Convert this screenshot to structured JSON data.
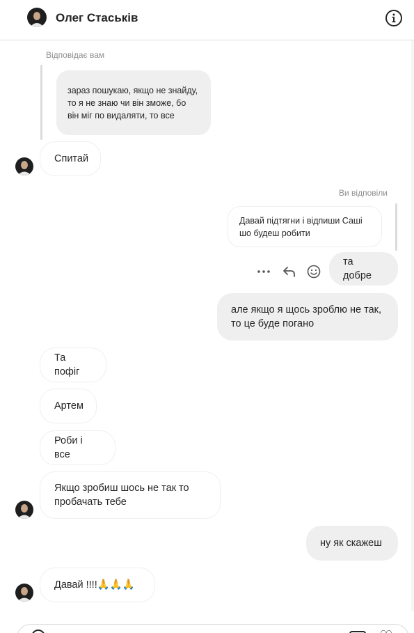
{
  "header": {
    "contact_name": "Олег Стаськів",
    "info_icon": "info-circle-icon"
  },
  "messages": {
    "reply_to_you_label": "Відповідає вам",
    "quoted_incoming": "зараз пошукаю, якщо не знайду, то я не знаю чи він зможе, бо він міг по видаляти, то все",
    "m1": "Спитай",
    "you_replied_label": "Ви відповіли",
    "quoted_outgoing": "Давай підтягни і відпиши Саші шо будеш робити",
    "m2": "та добре",
    "m3": "але якщо я щось зроблю не так, то це буде погано",
    "m4": "Та пофіг",
    "m5": "Артем",
    "m6": "Роби і все",
    "m7": "Якщо зробиш шось не так то пробачать тебе",
    "m8": "ну як скажеш",
    "m9": "Давай !!!!🙏🙏🙏"
  },
  "icons": {
    "more": "more-horizontal-icon",
    "reply": "reply-icon",
    "react": "emoji-icon"
  },
  "colors": {
    "outgoing_bubble": "#efefef",
    "incoming_bubble_border": "#efefef",
    "secondary_text": "#8e8e8e",
    "divider": "#dbdbdb"
  }
}
